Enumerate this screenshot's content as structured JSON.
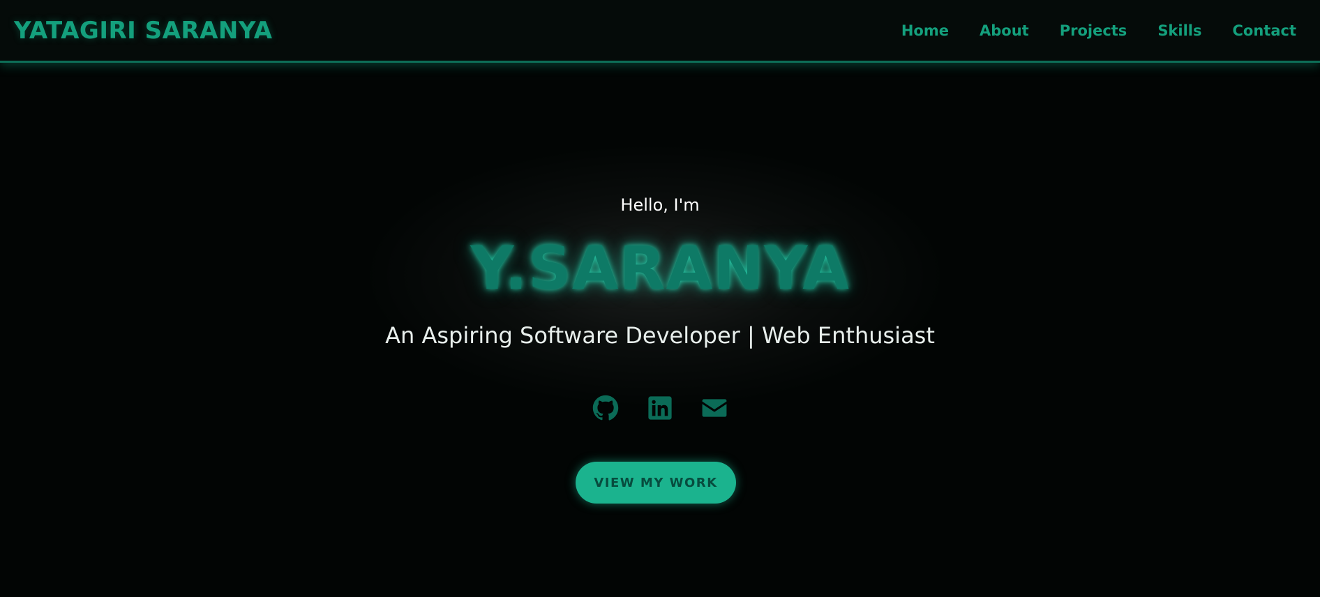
{
  "brand": {
    "name": "YATAGIRI SARANYA"
  },
  "nav": {
    "items": [
      {
        "label": "Home"
      },
      {
        "label": "About"
      },
      {
        "label": "Projects"
      },
      {
        "label": "Skills"
      },
      {
        "label": "Contact"
      }
    ]
  },
  "hero": {
    "greeting": "Hello, I'm",
    "name": "Y.SARANYA",
    "tagline": "An Aspiring Software Developer | Web Enthusiast",
    "cta_label": "VIEW MY WORK"
  },
  "socials": [
    {
      "icon": "github-icon"
    },
    {
      "icon": "linkedin-icon"
    },
    {
      "icon": "envelope-icon"
    }
  ],
  "colors": {
    "accent": "#14a07d",
    "button_bg": "#1bb38e",
    "background": "#020504"
  }
}
